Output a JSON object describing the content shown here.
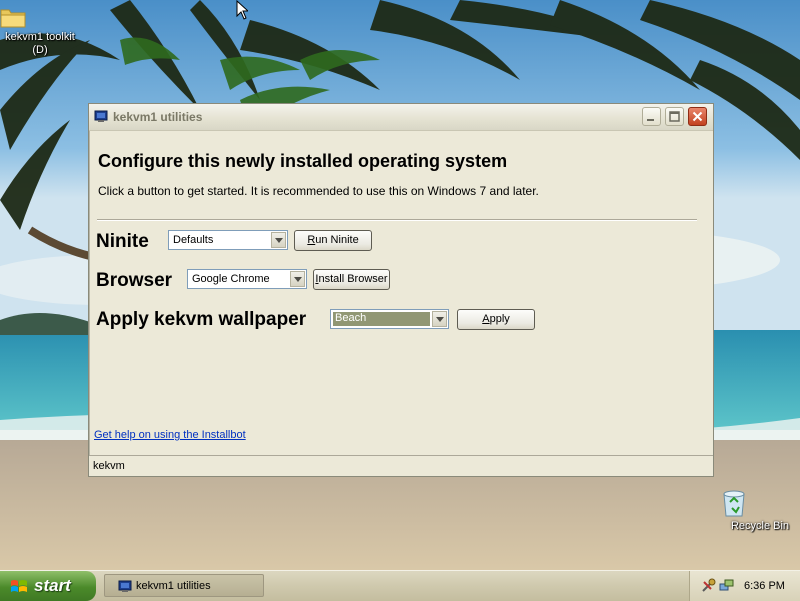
{
  "desktop": {
    "icons": [
      {
        "label_line1": "kekvm1 toolkit",
        "label_line2": "(D)",
        "icon": "folder-icon"
      },
      {
        "label": "Recycle Bin",
        "icon": "recycle-bin-icon"
      }
    ]
  },
  "window": {
    "title": "kekvm1 utilities",
    "heading": "Configure this newly installed operating system",
    "subtext": "Click a button to get started. It is recommended to use this on Windows 7 and later.",
    "rows": {
      "ninite": {
        "label": "Ninite",
        "select_value": "Defaults",
        "button": "Run Ninite",
        "button_mnemonic": "R",
        "button_rest": "un Ninite"
      },
      "browser": {
        "label": "Browser",
        "select_value": "Google Chrome",
        "button": "Install Browser",
        "button_mnemonic": "I",
        "button_rest": "nstall Browser"
      },
      "wallpaper": {
        "label": "Apply kekvm wallpaper",
        "select_value": "Beach",
        "button": "Apply",
        "button_mnemonic": "A",
        "button_rest": "pply"
      }
    },
    "help_link": "Get help on using the Installbot",
    "status": "kekvm"
  },
  "taskbar": {
    "start_label": "start",
    "task_item": "kekvm1 utilities",
    "clock": "6:36 PM"
  },
  "colors": {
    "window_bg": "#ece9d8",
    "start_green": "#4b8a2a",
    "link_blue": "#0030c0",
    "selected_combo": "#919774"
  }
}
